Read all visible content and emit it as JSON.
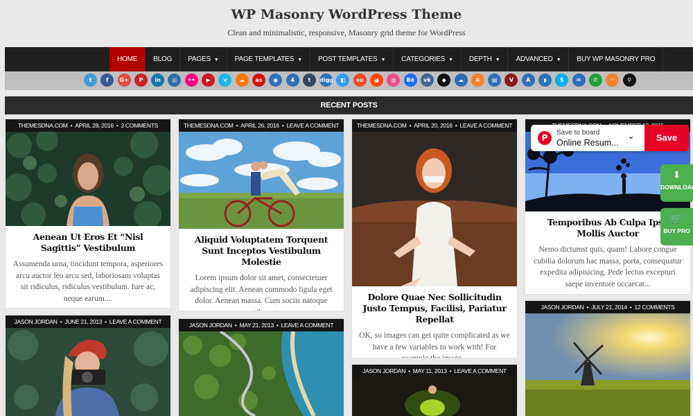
{
  "header": {
    "title": "WP Masonry WordPress Theme",
    "description": "Clean and minimalistic, responsive, Masonry grid theme for WordPress"
  },
  "nav": {
    "items": [
      {
        "label": "HOME",
        "active": true,
        "dropdown": false
      },
      {
        "label": "BLOG",
        "active": false,
        "dropdown": false
      },
      {
        "label": "PAGES",
        "active": false,
        "dropdown": true
      },
      {
        "label": "PAGE TEMPLATES",
        "active": false,
        "dropdown": true
      },
      {
        "label": "POST TEMPLATES",
        "active": false,
        "dropdown": true
      },
      {
        "label": "CATEGORIES",
        "active": false,
        "dropdown": true
      },
      {
        "label": "DEPTH",
        "active": false,
        "dropdown": true
      },
      {
        "label": "ADVANCED",
        "active": false,
        "dropdown": true
      },
      {
        "label": "BUY WP MASONRY PRO",
        "active": false,
        "dropdown": false
      }
    ],
    "caret_glyph": "▼"
  },
  "social": [
    {
      "name": "twitter-icon",
      "glyph": "t",
      "color": "#3d9ad6"
    },
    {
      "name": "facebook-icon",
      "glyph": "f",
      "color": "#3b5998"
    },
    {
      "name": "google-plus-icon",
      "glyph": "G+",
      "color": "#dc4e41"
    },
    {
      "name": "pinterest-icon",
      "glyph": "P",
      "color": "#cb2027"
    },
    {
      "name": "linkedin-icon",
      "glyph": "in",
      "color": "#0e76a8"
    },
    {
      "name": "instagram-icon",
      "glyph": "◎",
      "color": "#2a6fa3"
    },
    {
      "name": "flickr-icon",
      "glyph": "••",
      "color": "#ff0084"
    },
    {
      "name": "youtube-icon",
      "glyph": "▶",
      "color": "#cc181e"
    },
    {
      "name": "vimeo-icon",
      "glyph": "v",
      "color": "#1ab7ea"
    },
    {
      "name": "soundcloud-icon",
      "glyph": "☁",
      "color": "#ff7700"
    },
    {
      "name": "lastfm-icon",
      "glyph": "as",
      "color": "#d51007"
    },
    {
      "name": "github-icon",
      "glyph": "◉",
      "color": "#2c71b8"
    },
    {
      "name": "foursquare-icon",
      "glyph": "4",
      "color": "#2c71b8"
    },
    {
      "name": "tumblr-icon",
      "glyph": "t",
      "color": "#35465c"
    },
    {
      "name": "digg-icon",
      "glyph": "digg",
      "color": "#2c71b8"
    },
    {
      "name": "delicious-icon",
      "glyph": "◧",
      "color": "#3399ff"
    },
    {
      "name": "stumbleupon-icon",
      "glyph": "su",
      "color": "#eb4924"
    },
    {
      "name": "reddit-icon",
      "glyph": "◕",
      "color": "#ff4500"
    },
    {
      "name": "dribbble-icon",
      "glyph": "◍",
      "color": "#ea4c89"
    },
    {
      "name": "behance-icon",
      "glyph": "Bē",
      "color": "#1769ff"
    },
    {
      "name": "vk-icon",
      "glyph": "vk",
      "color": "#45668e"
    },
    {
      "name": "codepen-icon",
      "glyph": "◆",
      "color": "#111111"
    },
    {
      "name": "cloud-icon",
      "glyph": "☁",
      "color": "#2c71b8"
    },
    {
      "name": "stackoverflow-icon",
      "glyph": "≡",
      "color": "#f48024"
    },
    {
      "name": "comments-icon",
      "glyph": "▤",
      "color": "#2c71b8"
    },
    {
      "name": "vine-icon",
      "glyph": "V",
      "color": "#8a1a1a"
    },
    {
      "name": "app-store-icon",
      "glyph": "A",
      "color": "#2c71b8"
    },
    {
      "name": "android-icon",
      "glyph": "◗",
      "color": "#2c71b8"
    },
    {
      "name": "skype-icon",
      "glyph": "S",
      "color": "#00aff0"
    },
    {
      "name": "email-icon",
      "glyph": "✉",
      "color": "#2c71b8"
    },
    {
      "name": "phone-icon",
      "glyph": "✆",
      "color": "#1f9e3a"
    },
    {
      "name": "rss-icon",
      "glyph": "◠",
      "color": "#ee802f"
    },
    {
      "name": "search-icon",
      "glyph": "⚲",
      "color": "#111111"
    }
  ],
  "recent_posts_heading": "RECENT POSTS",
  "posts": [
    {
      "author": "THEMESDNA.COM",
      "date": "APRIL 28, 2016",
      "comments": "2 COMMENTS",
      "title": "Aenean Ut Eros Et “Nisl Sagittis” Vestibulum",
      "excerpt": "Assumenda urna, tincidunt tempora, asperiores arcu auctor leo arcu sed, laboriosam voluptas sit ridiculus, ridiculus vestibulum. Iure ac, neque earum...."
    },
    {
      "author": "THEMESDNA.COM",
      "date": "APRIL 26, 2016",
      "comments": "LEAVE A COMMENT",
      "title": "Aliquid Voluptatem Torquent Sunt Inceptos Vestibulum Molestie",
      "excerpt": "Lorem ipsum dolor sit amet, consectetuer adipiscing elit. Aenean commodo ligula eget dolor. Aenean massa. Cum sociis natoque penatibus et..."
    },
    {
      "author": "THEMESDNA.COM",
      "date": "APRIL 20, 2016",
      "comments": "LEAVE A COMMENT",
      "title": "Dolore Quae Nec Sollicitudin Justo Tempus, Facilisi, Pariatur Repellat",
      "excerpt": "OK, so images can get quite complicated as we have a few variables to work with! For example the image..."
    },
    {
      "author": "THEMESDNA.COM",
      "date": "NOVEMBER 10, 2015",
      "comments": "",
      "title": "Temporibus Ab Culpa Ipsa Mollis Auctor",
      "excerpt": "Nemo dictumst quis, quam! Labore congue cubilia dolorum hac massa, porta, consequatur expedita adipisicing. Pede lectus excepturi saepe inventore occaecat..."
    },
    {
      "author": "JASON JORDAN",
      "date": "JUNE 21, 2013",
      "comments": "LEAVE A COMMENT"
    },
    {
      "author": "JASON JORDAN",
      "date": "MAY 21, 2013",
      "comments": "LEAVE A COMMENT"
    },
    {
      "author": "JASON JORDAN",
      "date": "MAY 11, 2013",
      "comments": "LEAVE A COMMENT"
    },
    {
      "author": "JASON JORDAN",
      "date": "JULY 21, 2014",
      "comments": "12 COMMENTS"
    }
  ],
  "pinterest": {
    "logo_glyph": "P",
    "small_label": "Save to board",
    "board_name": "Online Resum...",
    "chevron_glyph": "⌄",
    "save_label": "Save"
  },
  "side_buttons": {
    "download_glyph": "⬇",
    "download_label": "DOWNLOAD",
    "buy_glyph": "🛒",
    "buy_label": "BUY PRO"
  },
  "meta_separator": "•"
}
